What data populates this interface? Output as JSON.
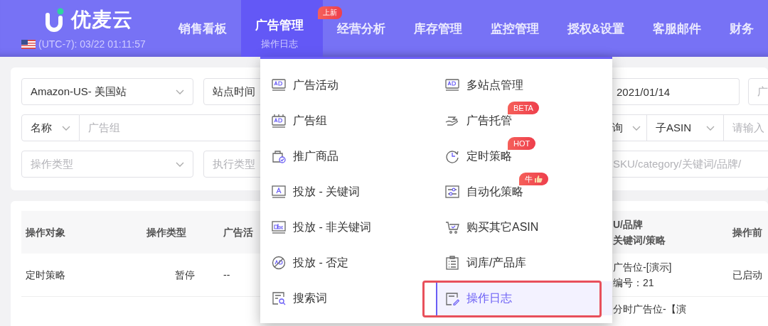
{
  "header": {
    "logo": "优麦云",
    "clock": "(UTC-7): 03/22 01:11:57",
    "nav": [
      {
        "label": "销售看板",
        "selected": false
      },
      {
        "label": "广告管理",
        "selected": true,
        "subtitle": "操作日志",
        "badge": "上新"
      },
      {
        "label": "经营分析",
        "selected": false
      },
      {
        "label": "库存管理",
        "selected": false
      },
      {
        "label": "监控管理",
        "selected": false
      },
      {
        "label": "授权&设置",
        "selected": false
      },
      {
        "label": "客服邮件",
        "selected": false
      },
      {
        "label": "财务",
        "selected": false
      }
    ]
  },
  "filters": {
    "marketplace": {
      "value": "Amazon-US- 美国站"
    },
    "time_type": {
      "value": "站点时间"
    },
    "date_end": {
      "value": "2021/01/14"
    },
    "field_6": {
      "placeholder": "广"
    },
    "search_by": {
      "value": "名称"
    },
    "search": {
      "placeholder": "广告组"
    },
    "query_type": {
      "value": "询"
    },
    "asin_type": {
      "value": "子ASIN"
    },
    "asin_search": {
      "placeholder": "请输入"
    },
    "operation_type": {
      "placeholder": "操作类型"
    },
    "execution_type": {
      "placeholder": "执行类型"
    },
    "keyword_search": {
      "placeholder": "SKU/category/关键词/品牌/"
    }
  },
  "table": {
    "columns": {
      "column_1": "操作对象",
      "column_2": "操作类型",
      "column_3": "广告活",
      "column_4": [
        "U/品牌",
        "关键词/策略"
      ],
      "column_5": "操作前"
    },
    "rows": [
      {
        "column_1": "定时策略",
        "column_2": "暂停",
        "column_3": "--",
        "column_4": [
          "广告位-[演示]",
          "编号：21"
        ],
        "column_5": "已启动"
      },
      {
        "column_4": [
          "分时广告位-【演"
        ]
      }
    ]
  },
  "menu": {
    "columns": [
      [
        {
          "label": "广告活动",
          "selected": false
        },
        {
          "label": "广告组",
          "selected": false
        },
        {
          "label": "推广商品",
          "selected": false
        },
        {
          "label": "投放 - 关键词",
          "selected": false
        },
        {
          "label": "投放 - 非关键词",
          "selected": false
        },
        {
          "label": "投放 - 否定",
          "selected": false
        },
        {
          "label": "搜索词",
          "selected": false
        }
      ],
      [
        {
          "label": "多站点管理",
          "selected": false
        },
        {
          "label": "广告托管",
          "selected": false,
          "badge": {
            "text": "BETA",
            "kind": "plain"
          }
        },
        {
          "label": "定时策略",
          "selected": false,
          "badge": {
            "text": "HOT",
            "kind": "plain"
          }
        },
        {
          "label": "自动化策略",
          "selected": false,
          "badge": {
            "text": "牛",
            "kind": "thumb"
          }
        },
        {
          "label": "购买其它ASIN",
          "selected": false
        },
        {
          "label": "词库/产品库",
          "selected": false
        },
        {
          "label": "操作日志",
          "selected": true,
          "annotated": true
        }
      ]
    ]
  }
}
